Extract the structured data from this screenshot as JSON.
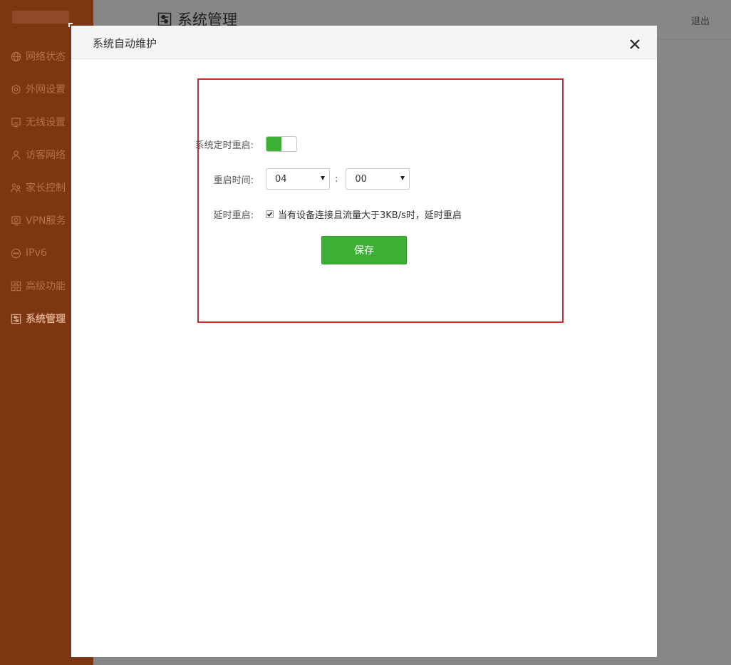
{
  "sidebar": {
    "items": [
      {
        "label": "网络状态",
        "icon": "globe-icon"
      },
      {
        "label": "外网设置",
        "icon": "gear-icon"
      },
      {
        "label": "无线设置",
        "icon": "wifi-icon"
      },
      {
        "label": "访客网络",
        "icon": "user-icon"
      },
      {
        "label": "家长控制",
        "icon": "family-icon"
      },
      {
        "label": "VPN服务",
        "icon": "vpn-icon"
      },
      {
        "label": "IPv6",
        "icon": "ipv6-icon"
      },
      {
        "label": "高级功能",
        "icon": "grid-icon"
      },
      {
        "label": "系统管理",
        "icon": "settings-icon",
        "active": true
      }
    ]
  },
  "header": {
    "title": "系统管理",
    "logout": "退出"
  },
  "modal": {
    "title": "系统自动维护",
    "form": {
      "reboot_label": "系统定时重启:",
      "reboot_enabled": true,
      "time_label": "重启时间:",
      "hour": "04",
      "minute": "00",
      "separator": ":",
      "delay_label": "延时重启:",
      "delay_checked": true,
      "delay_text": "当有设备连接且流量大于3KB/s时，延时重启",
      "save_label": "保存"
    }
  },
  "colors": {
    "accent": "#3cb034",
    "highlight": "#d22a2a",
    "sidebar": "#7d3512"
  }
}
